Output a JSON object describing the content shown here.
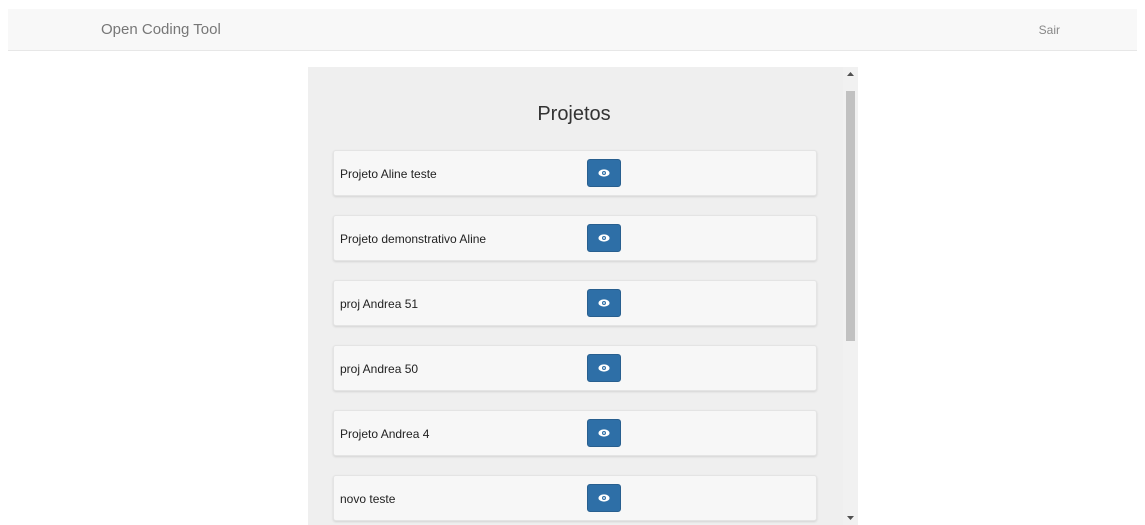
{
  "navbar": {
    "brand": "Open Coding Tool",
    "logout_label": "Sair"
  },
  "main": {
    "title": "Projetos",
    "projects": [
      {
        "name": "Projeto Aline teste"
      },
      {
        "name": "Projeto demonstrativo Aline"
      },
      {
        "name": "proj Andrea 51"
      },
      {
        "name": "proj Andrea 50"
      },
      {
        "name": "Projeto Andrea 4"
      },
      {
        "name": "novo teste"
      }
    ]
  },
  "icons": {
    "view": "eye-icon",
    "scroll_up": "scroll-up-arrow-icon",
    "scroll_down": "scroll-down-arrow-icon"
  },
  "colors": {
    "button_bg": "#2e6fa7",
    "panel_bg": "#efefef",
    "navbar_bg": "#f8f8f8"
  }
}
